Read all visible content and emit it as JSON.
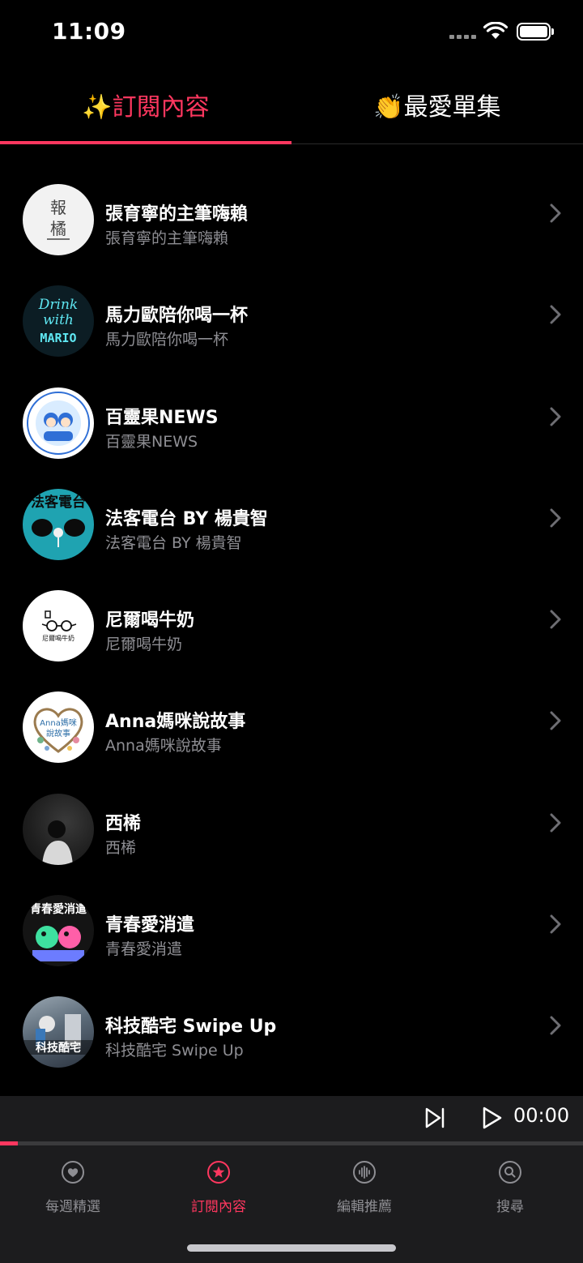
{
  "status_bar": {
    "time": "11:09"
  },
  "top_tabs": [
    {
      "label": "✨訂閱內容",
      "active": true
    },
    {
      "label": "👏最愛單集",
      "active": false
    }
  ],
  "podcasts": [
    {
      "title": "張育寧的主筆嗨賴",
      "subtitle": "張育寧的主筆嗨賴",
      "art": "baoju-logo",
      "art_text": [
        "報",
        "橘"
      ]
    },
    {
      "title": "馬力歐陪你喝一杯",
      "subtitle": "馬力歐陪你喝一杯",
      "art": "drink-with-mario",
      "art_text": [
        "Drink",
        "with",
        "MARIO"
      ]
    },
    {
      "title": "百靈果NEWS",
      "subtitle": "百靈果NEWS",
      "art": "world-news-illustration",
      "art_text": []
    },
    {
      "title": "法客電台 BY 楊貴智",
      "subtitle": "法客電台 BY 楊貴智",
      "art": "fake-radio-illustration",
      "art_text": [
        "法客電台"
      ]
    },
    {
      "title": "尼爾喝牛奶",
      "subtitle": "尼爾喝牛奶",
      "art": "glasses-logo",
      "art_text": [
        "尼爾喝牛奶"
      ]
    },
    {
      "title": "Anna媽咪說故事",
      "subtitle": "Anna媽咪說故事",
      "art": "heart-wreath-logo",
      "art_text": [
        "Anna媽咪",
        "說故事"
      ]
    },
    {
      "title": "西桸",
      "subtitle": "西桸",
      "art": "portrait-photo",
      "art_text": []
    },
    {
      "title": "青春愛消遣",
      "subtitle": "青春愛消遣",
      "art": "youth-illustration",
      "art_text": [
        "青春愛消遣"
      ]
    },
    {
      "title": "科技酷宅 Swipe Up",
      "subtitle": "科技酷宅 Swipe Up",
      "art": "tech-photo",
      "art_text": [
        "科技酷宅"
      ]
    }
  ],
  "player": {
    "time": "00:00",
    "progress": 0.03
  },
  "bottom_tabs": [
    {
      "label": "每週精選",
      "icon": "heart-icon",
      "active": false
    },
    {
      "label": "訂閱內容",
      "icon": "star-icon",
      "active": true
    },
    {
      "label": "編輯推薦",
      "icon": "waveform-icon",
      "active": false
    },
    {
      "label": "搜尋",
      "icon": "search-icon",
      "active": false
    }
  ],
  "colors": {
    "accent": "#ff375f",
    "background": "#000000",
    "secondary_text": "#8e8e93"
  }
}
